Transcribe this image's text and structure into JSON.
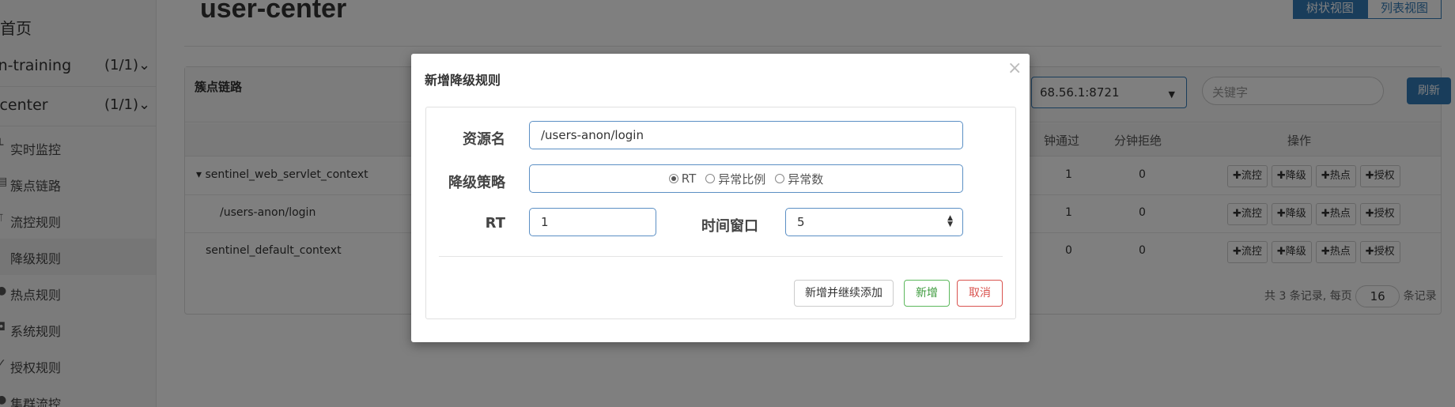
{
  "sidebar": {
    "home": "首页",
    "apps": [
      {
        "name": "on-training",
        "count": "(1/1)"
      },
      {
        "name": "r-center",
        "count": "(1/1)"
      }
    ],
    "menu": [
      {
        "icon": "dashboard-icon",
        "glyph": "└",
        "label": "实时监控"
      },
      {
        "icon": "list-icon",
        "glyph": "▤",
        "label": "簇点链路"
      },
      {
        "icon": "filter-icon",
        "glyph": "⫪",
        "label": "流控规则"
      },
      {
        "icon": "flash-icon",
        "glyph": "·",
        "label": "降级规则"
      },
      {
        "icon": "fire-icon",
        "glyph": "●",
        "label": "热点规则"
      },
      {
        "icon": "lock-icon",
        "glyph": "◘",
        "label": "系统规则"
      },
      {
        "icon": "check-icon",
        "glyph": "✓",
        "label": "授权规则"
      },
      {
        "icon": "cloud-icon",
        "glyph": "●",
        "label": "集群流控"
      }
    ]
  },
  "header": {
    "app_title": "user-center",
    "view_tree": "树状视图",
    "view_list": "列表视图"
  },
  "panel": {
    "title": "簇点链路",
    "machine": "68.56.1:8721",
    "keyword_placeholder": "关键字",
    "refresh": "刷新",
    "headers": {
      "pass": "钟通过",
      "reject": "分钟拒绝",
      "ops": "操作"
    },
    "rows": [
      {
        "resource": "▾ sentinel_web_servlet_context",
        "pass": "1",
        "reject": "0"
      },
      {
        "resource": "/users-anon/login",
        "pass": "1",
        "reject": "0"
      },
      {
        "resource": "sentinel_default_context",
        "pass": "0",
        "reject": "0"
      }
    ],
    "op_buttons": [
      "✚流控",
      "✚降级",
      "✚热点",
      "✚授权"
    ],
    "pager_prefix": "共 3 条记录, 每页",
    "page_size": "16",
    "pager_suffix": "条记录"
  },
  "modal": {
    "title": "新增降级规则",
    "close": "×",
    "resource_label": "资源名",
    "resource_value": "/users-anon/login",
    "strategy_label": "降级策略",
    "strategy_options": [
      "RT",
      "异常比例",
      "异常数"
    ],
    "strategy_selected": "RT",
    "rt_label": "RT",
    "rt_value": "1",
    "window_label": "时间窗口",
    "window_value": "5",
    "btn_continue": "新增并继续添加",
    "btn_add": "新增",
    "btn_cancel": "取消"
  }
}
